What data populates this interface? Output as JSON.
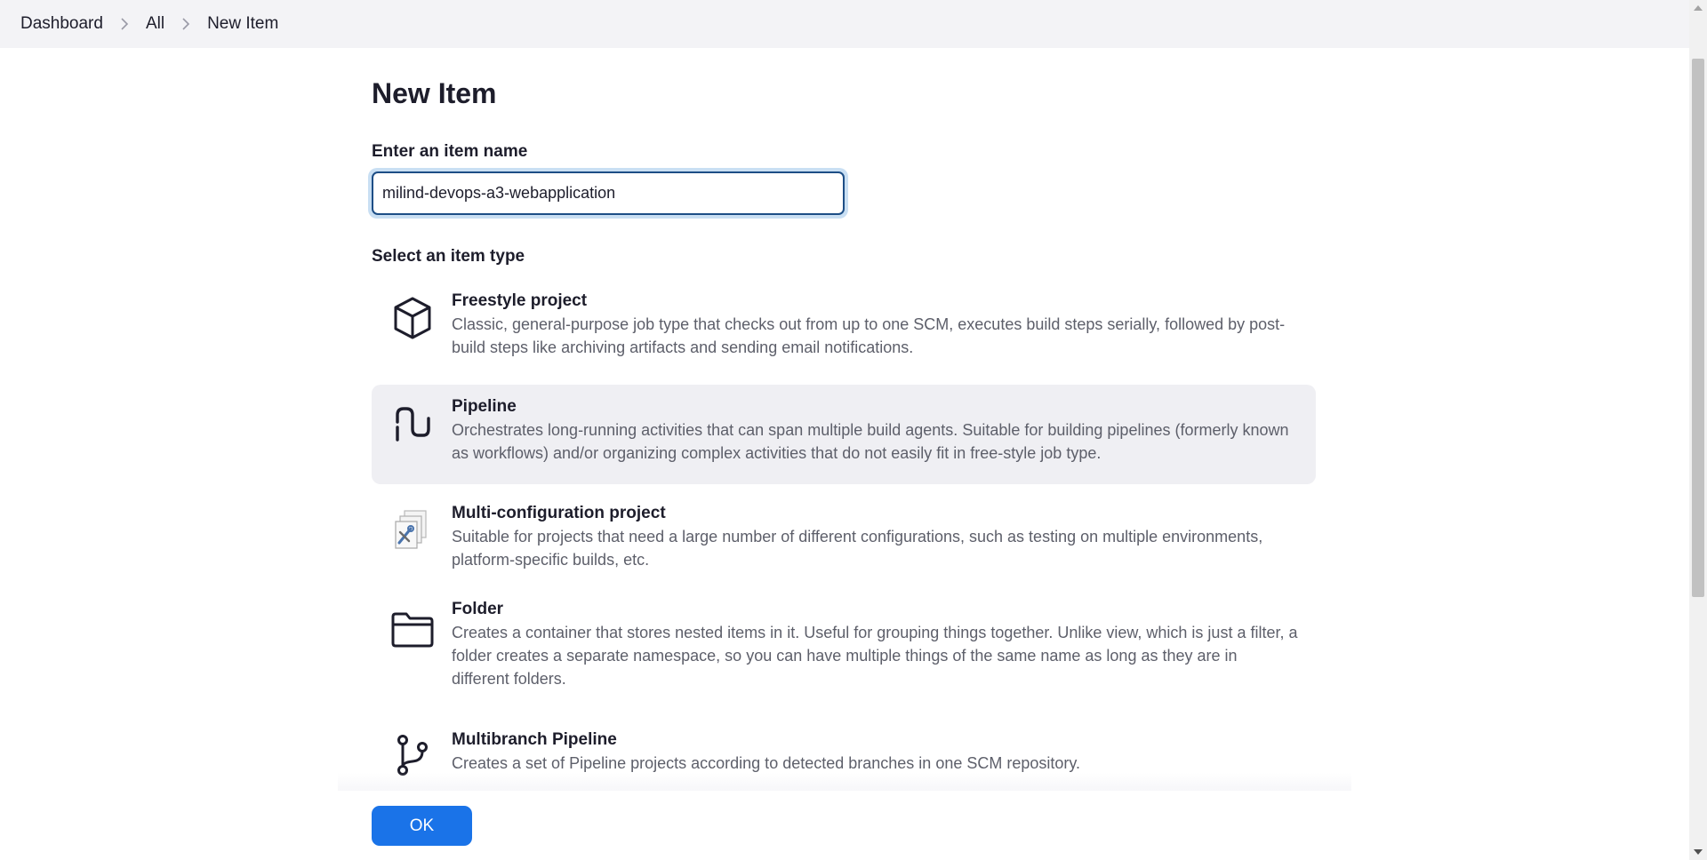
{
  "breadcrumb": {
    "items": [
      "Dashboard",
      "All",
      "New Item"
    ]
  },
  "page": {
    "title": "New Item",
    "name_label": "Enter an item name",
    "name_value": "milind-devops-a3-webapplication",
    "type_label": "Select an item type"
  },
  "item_types": [
    {
      "title": "Freestyle project",
      "description": "Classic, general-purpose job type that checks out from up to one SCM, executes build steps serially, followed by post-build steps like archiving artifacts and sending email notifications.",
      "icon": "package-icon",
      "selected": false
    },
    {
      "title": "Pipeline",
      "description": "Orchestrates long-running activities that can span multiple build agents. Suitable for building pipelines (formerly known as workflows) and/or organizing complex activities that do not easily fit in free-style job type.",
      "icon": "pipeline-icon",
      "selected": true
    },
    {
      "title": "Multi-configuration project",
      "description": "Suitable for projects that need a large number of different configurations, such as testing on multiple environments, platform-specific builds, etc.",
      "icon": "multi-config-icon",
      "selected": false
    },
    {
      "title": "Folder",
      "description": "Creates a container that stores nested items in it. Useful for grouping things together. Unlike view, which is just a filter, a folder creates a separate namespace, so you can have multiple things of the same name as long as they are in different folders.",
      "icon": "folder-icon",
      "selected": false
    },
    {
      "title": "Multibranch Pipeline",
      "description": "Creates a set of Pipeline projects according to detected branches in one SCM repository.",
      "icon": "branch-icon",
      "selected": false
    }
  ],
  "footer": {
    "ok_label": "OK"
  },
  "colors": {
    "accent": "#1a73e8",
    "selected_bg": "#efeff3",
    "topbar_bg": "#f3f3f6"
  }
}
